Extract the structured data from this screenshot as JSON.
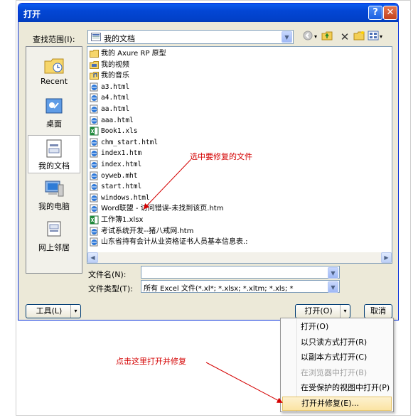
{
  "dialog": {
    "title": "打开",
    "help_glyph": "?",
    "close_glyph": "✕"
  },
  "lookin": {
    "label": "查找范围(I):",
    "value": "我的文档"
  },
  "places": [
    {
      "label": "Recent"
    },
    {
      "label": "桌面"
    },
    {
      "label": "我的文档"
    },
    {
      "label": "我的电脑"
    },
    {
      "label": "网上邻居"
    }
  ],
  "files": [
    {
      "name": "我的 Axure RP 原型",
      "type": "folder"
    },
    {
      "name": "我的视频",
      "type": "folder-video"
    },
    {
      "name": "我的音乐",
      "type": "folder-music"
    },
    {
      "name": "a3.html",
      "type": "html"
    },
    {
      "name": "a4.html",
      "type": "html"
    },
    {
      "name": "aa.html",
      "type": "html"
    },
    {
      "name": "aaa.html",
      "type": "html"
    },
    {
      "name": "Book1.xls",
      "type": "excel"
    },
    {
      "name": "chm_start.html",
      "type": "html"
    },
    {
      "name": "index1.htm",
      "type": "html"
    },
    {
      "name": "index.html",
      "type": "html"
    },
    {
      "name": "oyweb.mht",
      "type": "html"
    },
    {
      "name": "start.html",
      "type": "html"
    },
    {
      "name": "windows.html",
      "type": "html"
    },
    {
      "name": "Word联盟 - 访问错误-未找到该页.htm",
      "type": "html"
    },
    {
      "name": "工作簿1.xlsx",
      "type": "excel"
    },
    {
      "name": "考试系统开发--猪八戒网.htm",
      "type": "html"
    },
    {
      "name": "山东省持有会计从业资格证书人员基本信息表.:",
      "type": "html"
    }
  ],
  "filename": {
    "label": "文件名(N):",
    "value": ""
  },
  "filetype": {
    "label": "文件类型(T):",
    "value": "所有 Excel 文件(*.xl*; *.xlsx; *.xltm; *.xls; *"
  },
  "buttons": {
    "tools": "工具(L)",
    "open": "打开(O)",
    "cancel": "取消"
  },
  "open_menu": [
    {
      "label": "打开(O)",
      "disabled": false,
      "highlighted": false
    },
    {
      "label": "以只读方式打开(R)",
      "disabled": false,
      "highlighted": false
    },
    {
      "label": "以副本方式打开(C)",
      "disabled": false,
      "highlighted": false
    },
    {
      "label": "在浏览器中打开(B)",
      "disabled": true,
      "highlighted": false
    },
    {
      "label": "在受保护的视图中打开(P)",
      "disabled": false,
      "highlighted": false
    },
    {
      "label": "打开并修复(E)...",
      "disabled": false,
      "highlighted": true
    }
  ],
  "annotations": {
    "select_file": "选中要修复的文件",
    "click_repair": "点击这里打开并修复"
  },
  "colors": {
    "annotation": "#d40000",
    "titlebar": "#0346d4",
    "menu_highlight": "#fbe4a3"
  }
}
